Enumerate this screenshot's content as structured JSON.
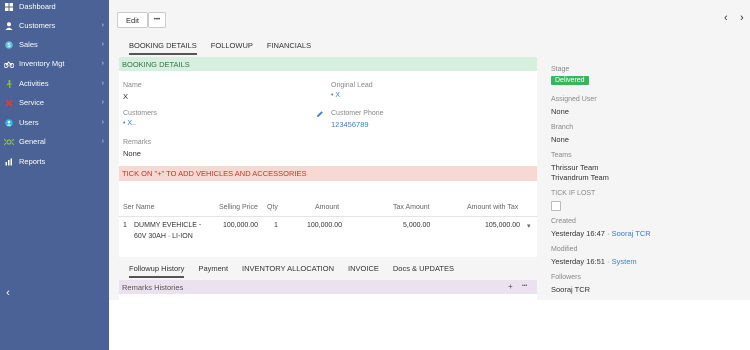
{
  "sidebar": {
    "items": [
      {
        "label": "Dashboard",
        "icon": "grid-icon",
        "arrow": false
      },
      {
        "label": "Customers",
        "icon": "person-icon",
        "arrow": true
      },
      {
        "label": "Sales",
        "icon": "sales-icon",
        "arrow": true
      },
      {
        "label": "Inventory Mgt",
        "icon": "bike-icon",
        "arrow": true
      },
      {
        "label": "Activities",
        "icon": "activity-icon",
        "arrow": true
      },
      {
        "label": "Service",
        "icon": "wrench-icon",
        "arrow": true
      },
      {
        "label": "Users",
        "icon": "user-icon",
        "arrow": true
      },
      {
        "label": "General",
        "icon": "gear-icon",
        "arrow": true
      },
      {
        "label": "Reports",
        "icon": "chart-icon",
        "arrow": false
      }
    ],
    "arrow_glyph": "›",
    "collapse_glyph": "‹"
  },
  "toolbar": {
    "edit_label": "Edit",
    "more_label": "•••",
    "prev_glyph": "‹",
    "next_glyph": "›"
  },
  "tabs_top": [
    "BOOKING DETAILS",
    "FOLLOWUP",
    "FINANCIALS"
  ],
  "booking": {
    "header": "BOOKING DETAILS",
    "name_label": "Name",
    "name_value": "X",
    "original_lead_label": "Original Lead",
    "original_lead_value": "• X",
    "customers_label": "Customers",
    "customers_value": "• X..",
    "customer_phone_label": "Customer Phone",
    "customer_phone_value": "123456789",
    "remarks_label": "Remarks",
    "remarks_value": "None"
  },
  "vehicles": {
    "header": "TICK ON \"+\" TO ADD VEHICLES AND ACCESSORIES",
    "columns": [
      "Ser Name",
      "Selling Price",
      "Qty",
      "Amount",
      "Tax Amount",
      "Amount with Tax"
    ],
    "row": {
      "num": "1",
      "name_line1": "DUMMY EVEHICLE -",
      "name_line2": "60V 30AH · LI-ION",
      "selling_price": "100,000.00",
      "qty": "1",
      "amount": "100,000.00",
      "tax_amount": "5,000.00",
      "amount_with_tax": "105,000.00",
      "menu": "▾"
    }
  },
  "tabs_bottom": [
    "Followup History",
    "Payment",
    "INVENTORY ALLOCATION",
    "INVOICE",
    "Docs & UPDATES"
  ],
  "remarks_histories": {
    "header": "Remarks Histories",
    "add": "+",
    "more": "•••"
  },
  "side": {
    "stage_label": "Stage",
    "stage_value": "Delivered",
    "assigned_label": "Assigned User",
    "assigned_value": "None",
    "branch_label": "Branch",
    "branch_value": "None",
    "teams_label": "Teams",
    "team1": "Thrissur Team",
    "team2": "Trivandrum Team",
    "lost_label": "TICK IF LOST",
    "created_label": "Created",
    "created_time": "Yesterday 16:47",
    "created_by": "· Sooraj TCR",
    "modified_label": "Modified",
    "modified_time": "Yesterday 16:51",
    "modified_by": "· System",
    "followers_label": "Followers",
    "followers_value": "Sooraj TCR"
  },
  "colors": {
    "sidebar": "#4a6295",
    "green_header": "#d7efde",
    "red_header": "#f8d8d3",
    "purple_header": "#ebe1ef",
    "badge": "#3bb55c",
    "link": "#3d7ec8"
  }
}
